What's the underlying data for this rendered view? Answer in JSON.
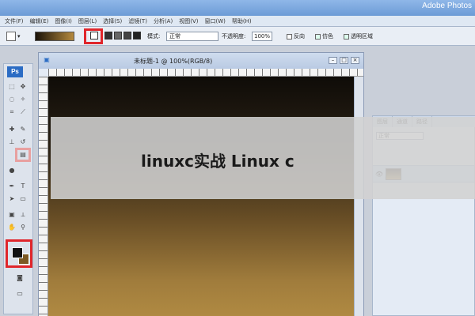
{
  "window": {
    "app_title": "Adobe Photos"
  },
  "menu": [
    "文件(F)",
    "编辑(E)",
    "图像(I)",
    "图层(L)",
    "选择(S)",
    "滤镜(T)",
    "分析(A)",
    "视图(V)",
    "窗口(W)",
    "帮助(H)"
  ],
  "options": {
    "mode_label": "模式:",
    "mode_value": "正常",
    "opacity_label": "不透明度:",
    "opacity_value": "100%",
    "reverse_label": "反向",
    "dither_label": "仿色",
    "transparency_label": "透明区域"
  },
  "document": {
    "title": "未标题-1 @ 100%(RGB/8)"
  },
  "tools": {
    "logo": "Ps"
  },
  "layers_panel": {
    "tabs": [
      "图层",
      "通道",
      "路径"
    ],
    "mode_value": "正常"
  },
  "overlay": {
    "caption": "linuxc实战 Linux c"
  },
  "colors": {
    "highlight": "#e0262b",
    "foreground": "#111111",
    "background": "#7b5a24"
  }
}
